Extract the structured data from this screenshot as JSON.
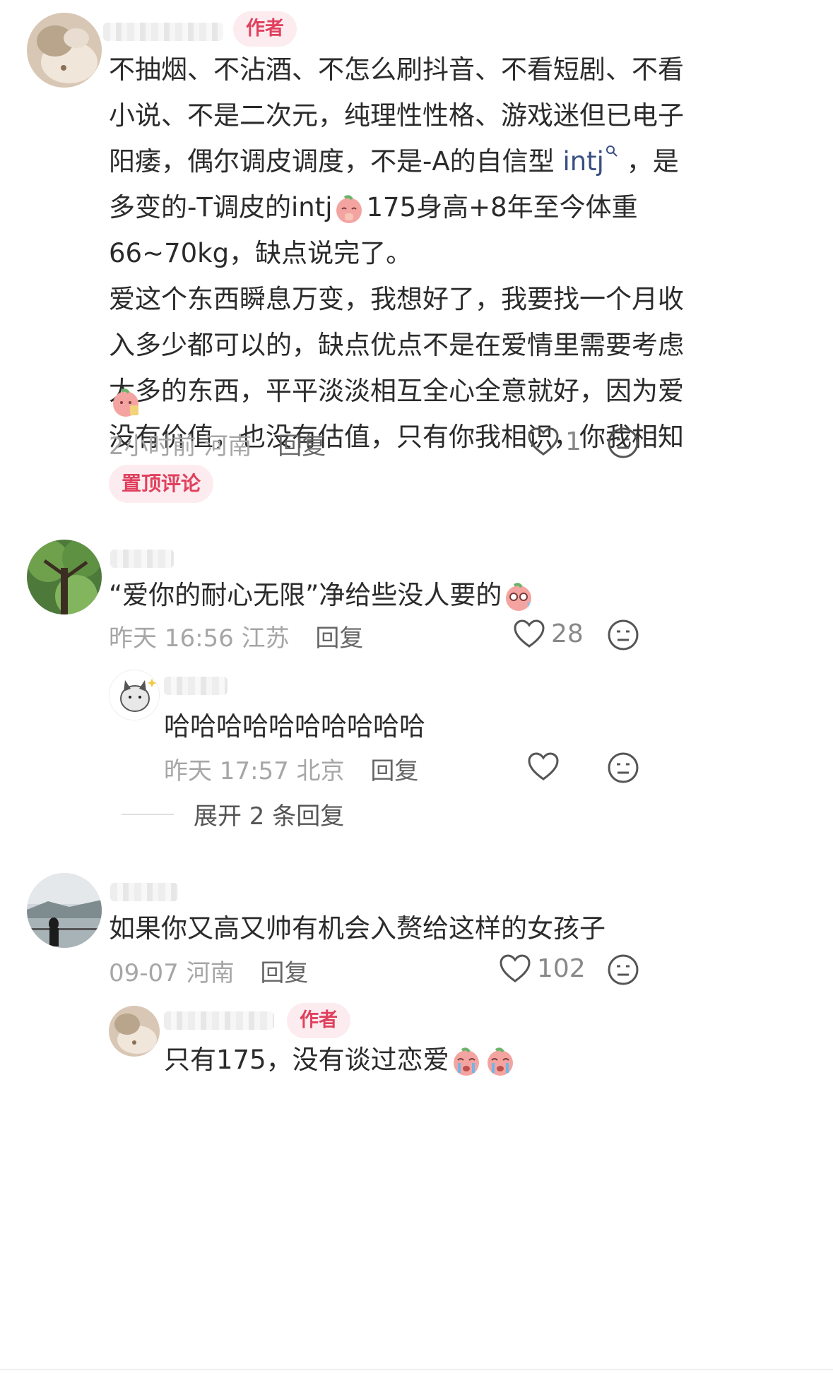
{
  "comments": [
    {
      "author_badge": "作者",
      "lines": [
        "不抽烟、不沾酒、不怎么刷抖音、不看短剧、不看",
        "小说、不是二次元，纯理性性格、游戏迷但已电子",
        "阳痿，偶尔调皮调度，不是-A的自信型 ",
        "多变的-T调皮的intj",
        " 66~70kg，缺点说完了。",
        "爱这个东西瞬息万变，我想好了，我要找一个月收",
        "入多少都可以的，缺点优点不是在爱情里需要考虑",
        "太多的东西，平平淡淡相互全心全意就好，因为爱",
        "没有价值，也没有估值，只有你我相识，你我相知"
      ],
      "link_word": "intj",
      "line3_tail": " ，是",
      "line4_tail": "175身高+8年至今体重",
      "time": "2小时前",
      "location": "河南",
      "reply": "回复",
      "likes": "1",
      "pinned": "置顶评论"
    },
    {
      "text": "“爱你的耐心无限”净给些没人要的",
      "time": "昨天 16:56",
      "location": "江苏",
      "reply": "回复",
      "likes": "28"
    },
    {
      "text": "哈哈哈哈哈哈哈哈哈哈",
      "time": "昨天 17:57",
      "location": "北京",
      "reply": "回复",
      "likes": ""
    },
    {
      "text": "如果你又高又帅有机会入赘给这样的女孩子",
      "time": "09-07",
      "location": "河南",
      "reply": "回复",
      "likes": "102"
    },
    {
      "author_badge": "作者",
      "text": "只有175，没有谈过恋爱"
    }
  ],
  "expand_replies": "展开 2 条回复",
  "icons": {
    "like": "heart-outline-icon",
    "dislike": "neutral-face-icon",
    "search": "search-icon"
  },
  "colors": {
    "accent": "#e0405e",
    "link": "#3a4f82",
    "meta": "#a6a6a6"
  }
}
